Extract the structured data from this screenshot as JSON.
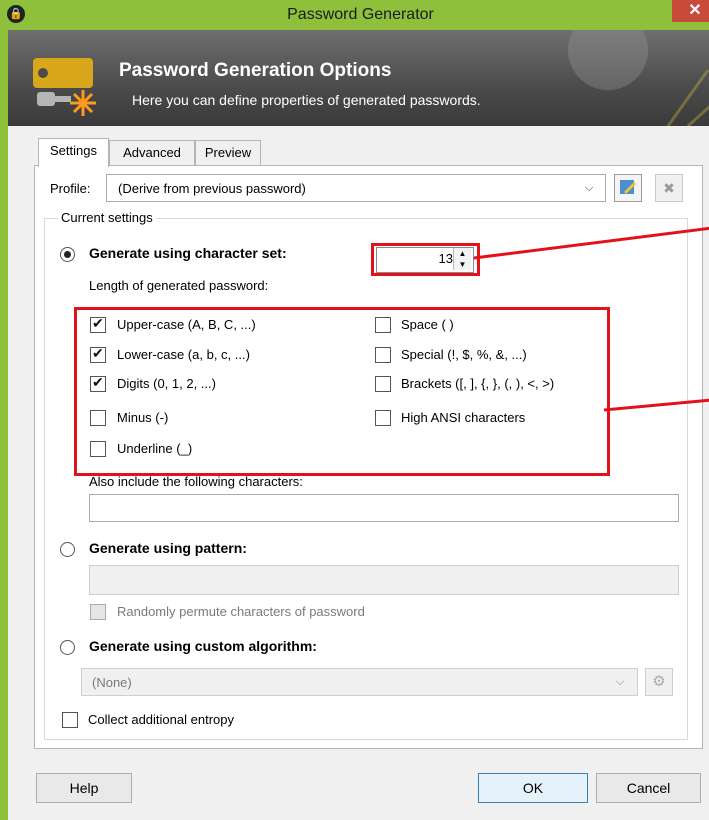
{
  "window": {
    "title": "Password Generator",
    "close_glyph": "✕"
  },
  "banner": {
    "title": "Password Generation Options",
    "subtitle": "Here you can define properties of generated passwords."
  },
  "tabs": [
    {
      "label": "Settings",
      "active": true
    },
    {
      "label": "Advanced",
      "active": false
    },
    {
      "label": "Preview",
      "active": false
    }
  ],
  "profile": {
    "label": "Profile:",
    "value": "(Derive from previous password)"
  },
  "current_settings": {
    "legend": "Current settings"
  },
  "charset": {
    "radio_label": "Generate using character set:",
    "selected": true,
    "length_label": "Length of generated password:",
    "length_value": "13",
    "options_left": [
      {
        "label": "Upper-case (A, B, C, ...)",
        "checked": true
      },
      {
        "label": "Lower-case (a, b, c, ...)",
        "checked": true
      },
      {
        "label": "Digits (0, 1, 2, ...)",
        "checked": true
      },
      {
        "label": "Minus (-)",
        "checked": false
      },
      {
        "label": "Underline (_)",
        "checked": false
      }
    ],
    "options_right": [
      {
        "label": "Space ( )",
        "checked": false
      },
      {
        "label": "Special (!, $, %, &, ...)",
        "checked": false
      },
      {
        "label": "Brackets ([, ], {, }, (, ), <, >)",
        "checked": false
      },
      {
        "label": "High ANSI characters",
        "checked": false
      }
    ],
    "also_include_label": "Also include the following characters:",
    "also_include_value": ""
  },
  "pattern": {
    "radio_label": "Generate using pattern:",
    "selected": false,
    "value": "",
    "permute_label": "Randomly permute characters of password"
  },
  "custom": {
    "radio_label": "Generate using custom algorithm:",
    "selected": false,
    "value": "(None)"
  },
  "entropy": {
    "label": "Collect additional entropy",
    "checked": false
  },
  "buttons": {
    "help": "Help",
    "ok": "OK",
    "cancel": "Cancel"
  },
  "colors": {
    "frame": "#8ec03b",
    "annotation": "#e3121a",
    "close": "#c84a3a"
  },
  "icons": [
    "keepass-lock-icon",
    "close-icon",
    "key-icon",
    "edit-profile-icon",
    "delete-profile-icon",
    "chevron-down-icon",
    "gear-icon",
    "spin-up-icon",
    "spin-down-icon"
  ]
}
